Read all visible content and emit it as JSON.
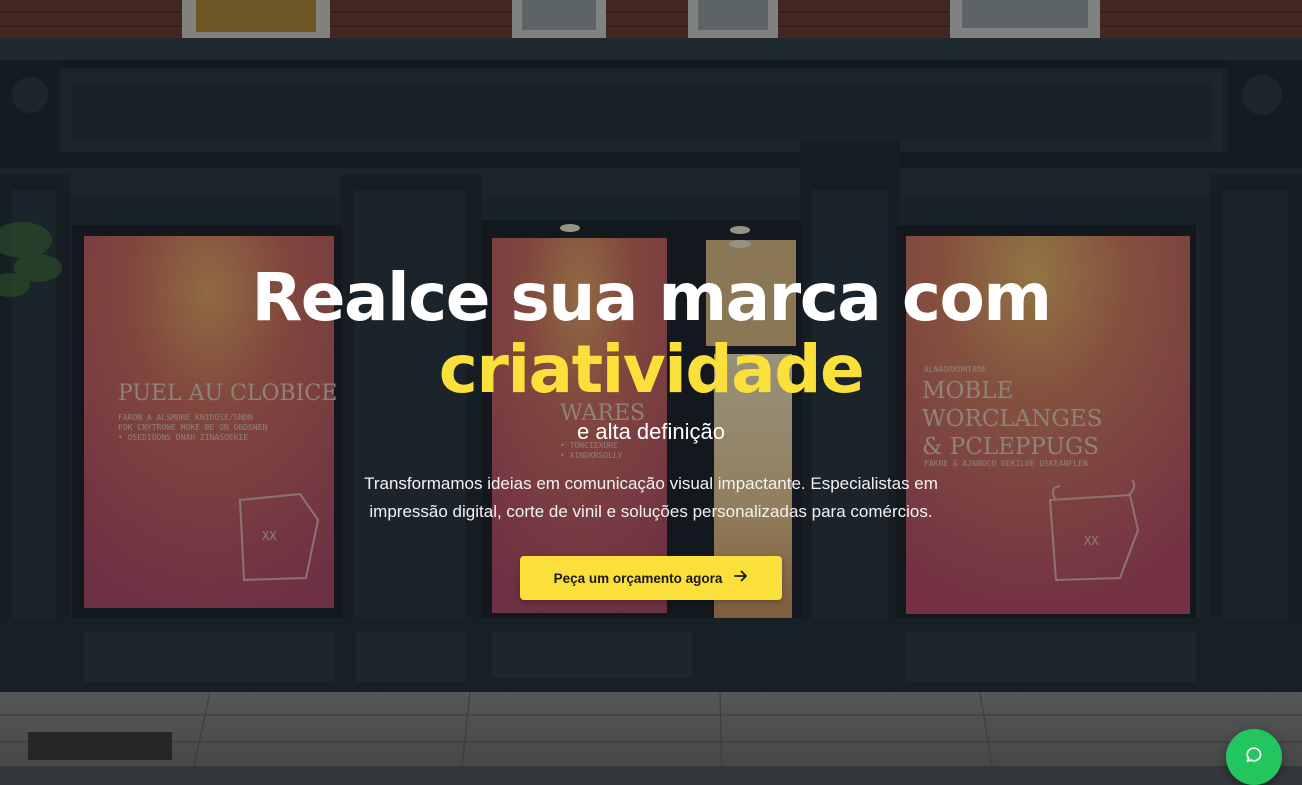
{
  "hero": {
    "title_line1": "Realce sua marca com",
    "title_accent": "criatividade",
    "subtitle": "e alta definição",
    "description": "Transformamos ideias em comunicação visual impactante. Especialistas em impressão digital, corte de vinil e soluções personalizadas para comércios.",
    "cta_label": "Peça um orçamento agora",
    "cta_icon": "arrow-right-icon"
  },
  "background": {
    "left_poster_title": "PUEL AU CLOBICE",
    "left_poster_lines": [
      "FARON A ALSMORE KNIDOSE/SNDN",
      "FOK CNYTRONE MOKE BE ON OBDSNEN",
      "• OSEDIOONS DNAH ZINASOEKIE"
    ],
    "center_poster_title": "WARES",
    "center_poster_lines": [
      "• TONCIEXURE",
      "• XINDKRSOLLY"
    ],
    "right_poster_eyebrow": "ALNAORKDMTANE",
    "right_poster_title": "MOBLE WORCLANGES & PCLEPPUGS",
    "right_poster_line": "FAKNE & AJNBOCO DEKILOE DSKEANFLEN",
    "bag_mark": "XX"
  },
  "chat": {
    "icon": "chat-bubble-icon"
  },
  "colors": {
    "accent": "#fbe03c",
    "chat": "#22c55e",
    "text": "#ffffff"
  }
}
